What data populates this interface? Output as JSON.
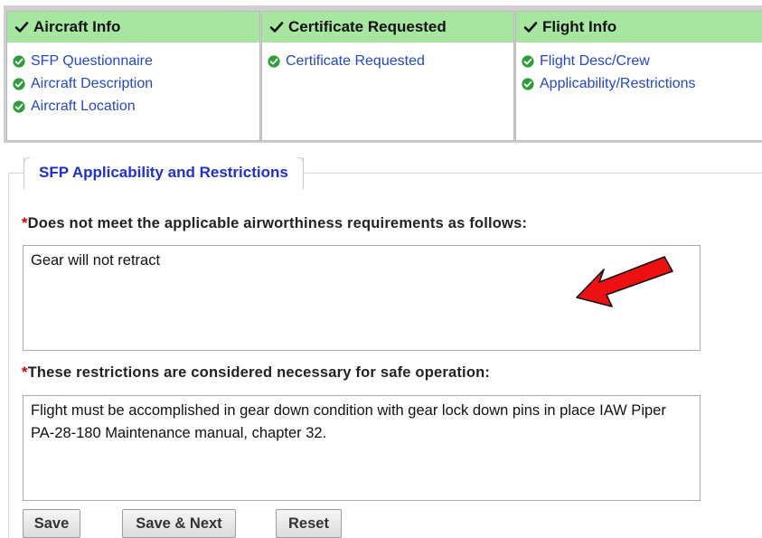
{
  "steps": [
    {
      "title": "Aircraft Info",
      "links": [
        "SFP Questionnaire",
        "Aircraft Description",
        "Aircraft Location"
      ]
    },
    {
      "title": "Certificate Requested",
      "links": [
        "Certificate Requested"
      ]
    },
    {
      "title": "Flight Info",
      "links": [
        "Flight Desc/Crew",
        "Applicability/Restrictions"
      ]
    }
  ],
  "section": {
    "legend": "SFP Applicability and Restrictions",
    "required_marker": "*",
    "field1": {
      "label": "Does not meet the applicable airworthiness requirements as follows:",
      "value": "Gear will not retract"
    },
    "field2": {
      "label": "These restrictions are considered necessary for safe operation:",
      "value": "Flight must be accomplished in gear down condition with gear lock down pins in place IAW Piper PA-28-180 Maintenance manual, chapter 32."
    }
  },
  "buttons": {
    "save": "Save",
    "save_next": "Save & Next",
    "reset": "Reset"
  },
  "colors": {
    "header_green": "#a6e6a0",
    "link_blue": "#2547c9",
    "legend_blue": "#1f2fd0",
    "required_red": "#d40000",
    "check_green": "#2e9e3a",
    "annotation_arrow": "#ee1111"
  },
  "icons": {
    "header_check": "check-icon",
    "link_status": "check-circle-icon",
    "annotation": "red-arrow-icon"
  }
}
